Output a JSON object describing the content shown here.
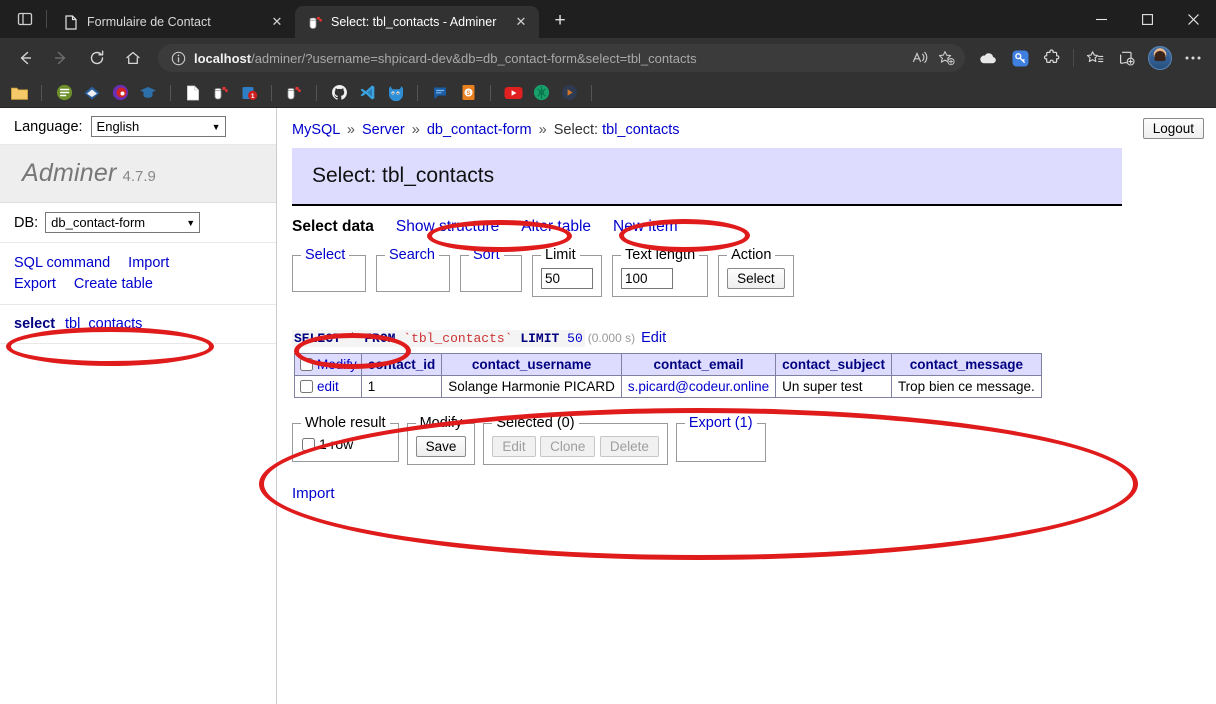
{
  "browser": {
    "tabs": [
      {
        "title": "Formulaire de Contact",
        "favicon": "page-icon",
        "active": false
      },
      {
        "title": "Select: tbl_contacts - Adminer",
        "favicon": "adminer-database-icon",
        "active": true
      }
    ],
    "new_tab_label": "+",
    "window_controls": {
      "minimize": "—",
      "maximize": "☐",
      "close": "✕"
    },
    "nav": {
      "back": "←",
      "forward": "→",
      "reload": "↻",
      "home": "⌂"
    },
    "omnibox": {
      "info_icon": "info-circle-icon",
      "url_host": "localhost",
      "url_path": "/adminer/?username=shpicard-dev&db=db_contact-form&select=tbl_contacts",
      "read_aloud_icon": "read-aloud-icon",
      "favorite_icon": "add-favorite-star-icon"
    },
    "toolbar_icons": [
      "onedrive-cloud-icon",
      "password-key-icon",
      "extensions-puzzle-icon",
      "favorites-star-list-icon",
      "collections-icon",
      "profile-avatar",
      "settings-ellipsis-icon"
    ],
    "bookmarks": [
      "folder-icon",
      "sep",
      "green-list-icon",
      "blue-diamond-icon",
      "purple-record-icon",
      "graduation-cap-icon",
      "sep",
      "white-page-icon",
      "adminer-icon",
      "blue-badge-1-icon",
      "sep",
      "adminer-icon-2",
      "sep",
      "github-icon",
      "vscode-icon",
      "gitlab-cat-icon",
      "sep",
      "blue-chat-icon",
      "orange-book-icon",
      "sep",
      "youtube-icon",
      "green-paint-icon",
      "dark-play-icon",
      "sep"
    ]
  },
  "sidebar": {
    "language_label": "Language:",
    "language_value": "English",
    "brand_name": "Adminer",
    "brand_version": "4.7.9",
    "db_label": "DB:",
    "db_value": "db_contact-form",
    "links": [
      {
        "label": "SQL command"
      },
      {
        "label": "Import"
      },
      {
        "label": "Export"
      },
      {
        "label": "Create table"
      }
    ],
    "table_action": "select",
    "table_name": "tbl_contacts"
  },
  "header": {
    "logout_label": "Logout",
    "breadcrumb": {
      "server_type": "MySQL",
      "server": "Server",
      "database": "db_contact-form",
      "select_label": "Select:",
      "table": "tbl_contacts",
      "separator": "»"
    },
    "page_title": "Select: tbl_contacts"
  },
  "tabs": [
    {
      "label": "Select data",
      "current": true
    },
    {
      "label": "Show structure",
      "current": false
    },
    {
      "label": "Alter table",
      "current": false
    },
    {
      "label": "New item",
      "current": false
    }
  ],
  "filters": {
    "select_legend": "Select",
    "search_legend": "Search",
    "sort_legend": "Sort",
    "limit_legend": "Limit",
    "limit_value": "50",
    "text_length_legend": "Text length",
    "text_length_value": "100",
    "action_legend": "Action",
    "action_button": "Select"
  },
  "query": {
    "keyword_select": "SELECT",
    "star": "*",
    "keyword_from": "FROM",
    "table": "`tbl_contacts`",
    "keyword_limit": "LIMIT",
    "limit": "50",
    "time": "(0.000 s)",
    "edit_link": "Edit"
  },
  "table": {
    "modify_header": "Modify",
    "columns": [
      "contact_id",
      "contact_username",
      "contact_email",
      "contact_subject",
      "contact_message"
    ],
    "rows": [
      {
        "edit_label": "edit",
        "contact_id": "1",
        "contact_username": "Solange Harmonie PICARD",
        "contact_email": "s.picard@codeur.online",
        "contact_subject": "Un super test",
        "contact_message": "Trop bien ce message."
      }
    ]
  },
  "footer": {
    "whole_result_legend": "Whole result",
    "row_count_label": "1 row",
    "modify_legend": "Modify",
    "save_button": "Save",
    "selected_legend": "Selected (0)",
    "edit_button": "Edit",
    "clone_button": "Clone",
    "delete_button": "Delete",
    "export_legend": "Export (1)",
    "import_link": "Import"
  },
  "annotations": {
    "color": "#e01b1b",
    "ellipses": [
      "db-selector-ellipse",
      "breadcrumb-database-ellipse",
      "breadcrumb-table-ellipse",
      "select-data-tab-ellipse",
      "results-region-ellipse"
    ]
  }
}
